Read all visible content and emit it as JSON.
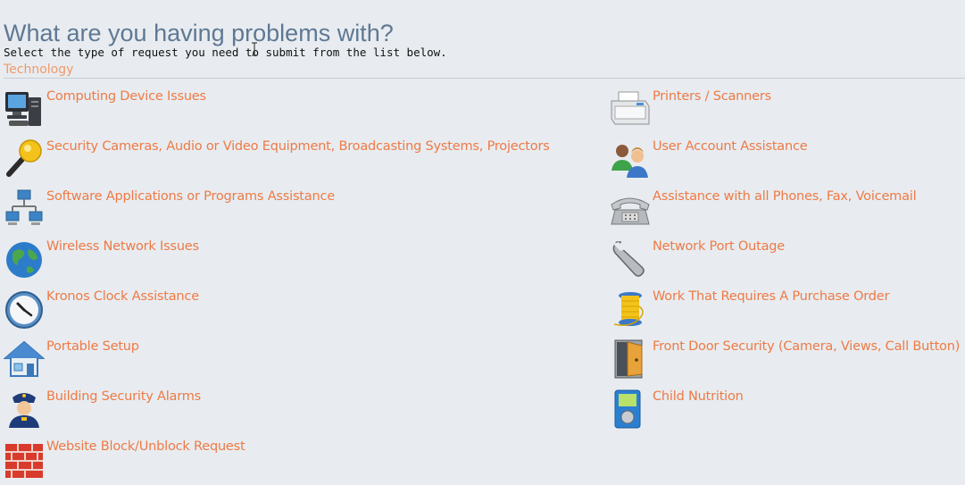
{
  "page": {
    "title": "What are you having problems with?",
    "subtitle": "Select the type of request you need to submit from the list below.",
    "section": "Technology"
  },
  "colors": {
    "title": "#5f7894",
    "link": "#ee7a45",
    "section": "#ef9a6a",
    "background": "#e8ecf0"
  },
  "left_items": [
    {
      "label": "Computing Device Issues",
      "icon": "computer-icon"
    },
    {
      "label": "Security Cameras, Audio or Video Equipment, Broadcasting Systems, Projectors",
      "icon": "microphone-icon"
    },
    {
      "label": "Software Applications or Programs Assistance",
      "icon": "network-computers-icon"
    },
    {
      "label": "Wireless Network Issues",
      "icon": "globe-icon"
    },
    {
      "label": "Kronos Clock Assistance",
      "icon": "clock-icon"
    },
    {
      "label": "Portable Setup",
      "icon": "house-icon"
    },
    {
      "label": "Building Security Alarms",
      "icon": "police-officer-icon"
    },
    {
      "label": "Website Block/Unblock Request",
      "icon": "firewall-icon"
    }
  ],
  "right_items": [
    {
      "label": "Printers / Scanners",
      "icon": "printer-icon"
    },
    {
      "label": "User Account Assistance",
      "icon": "users-icon"
    },
    {
      "label": "Assistance with all Phones, Fax, Voicemail",
      "icon": "telephone-icon"
    },
    {
      "label": "Network Port Outage",
      "icon": "wrench-icon"
    },
    {
      "label": "Work That Requires A Purchase Order",
      "icon": "thread-spool-icon"
    },
    {
      "label": "Front Door Security (Camera, Views, Call Button)",
      "icon": "door-icon"
    },
    {
      "label": "Child Nutrition",
      "icon": "device-icon"
    }
  ]
}
